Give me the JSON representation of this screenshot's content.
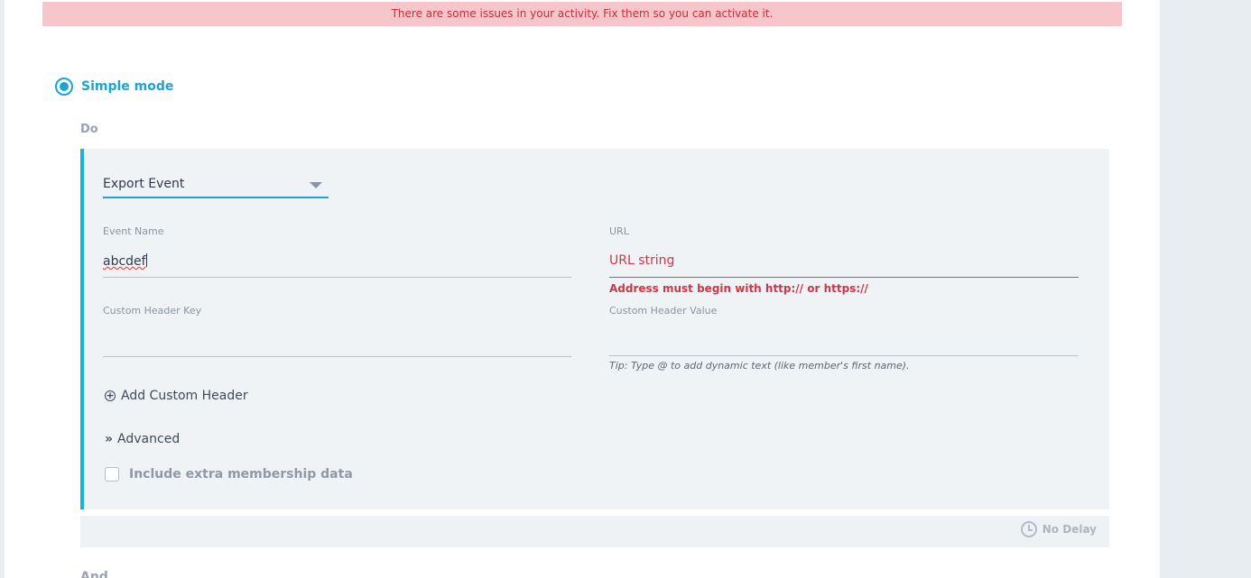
{
  "banner": {
    "message": "There are some issues in your activity. Fix them so you can activate it."
  },
  "mode": {
    "label": "Simple mode"
  },
  "section": {
    "do_label": "Do",
    "next_label_partial": "And then"
  },
  "action": {
    "type_value": "Export Event",
    "event_name": {
      "label": "Event Name",
      "value": "abcdef"
    },
    "url": {
      "label": "URL",
      "value": "URL string",
      "error": "Address must begin with http:// or https://"
    },
    "custom_header_key": {
      "label": "Custom Header Key",
      "value": ""
    },
    "custom_header_value": {
      "label": "Custom Header Value",
      "value": "",
      "tip": "Tip: Type @ to add dynamic text (like member's first name)."
    },
    "add_custom_header_label": "Add Custom Header",
    "advanced_label": "Advanced",
    "include_membership_label": "Include extra membership data"
  },
  "delay": {
    "label": "No Delay"
  },
  "colors": {
    "accent": "#1aa6d0",
    "error": "#c9394a",
    "banner_bg": "#f6c6cb"
  },
  "icons": {
    "add": "circle-plus-icon",
    "advanced": "double-chevron-right-icon",
    "delay": "alarm-clock-icon",
    "select": "caret-down-icon"
  }
}
